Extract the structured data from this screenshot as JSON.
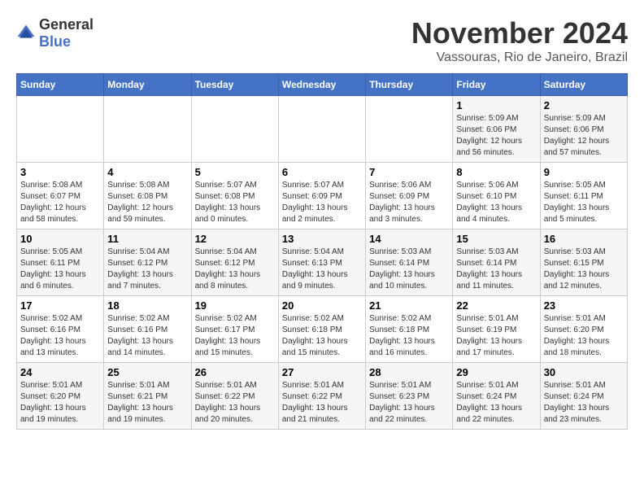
{
  "logo": {
    "general": "General",
    "blue": "Blue"
  },
  "header": {
    "month": "November 2024",
    "location": "Vassouras, Rio de Janeiro, Brazil"
  },
  "weekdays": [
    "Sunday",
    "Monday",
    "Tuesday",
    "Wednesday",
    "Thursday",
    "Friday",
    "Saturday"
  ],
  "weeks": [
    [
      {
        "day": "",
        "info": ""
      },
      {
        "day": "",
        "info": ""
      },
      {
        "day": "",
        "info": ""
      },
      {
        "day": "",
        "info": ""
      },
      {
        "day": "",
        "info": ""
      },
      {
        "day": "1",
        "info": "Sunrise: 5:09 AM\nSunset: 6:06 PM\nDaylight: 12 hours\nand 56 minutes."
      },
      {
        "day": "2",
        "info": "Sunrise: 5:09 AM\nSunset: 6:06 PM\nDaylight: 12 hours\nand 57 minutes."
      }
    ],
    [
      {
        "day": "3",
        "info": "Sunrise: 5:08 AM\nSunset: 6:07 PM\nDaylight: 12 hours\nand 58 minutes."
      },
      {
        "day": "4",
        "info": "Sunrise: 5:08 AM\nSunset: 6:08 PM\nDaylight: 12 hours\nand 59 minutes."
      },
      {
        "day": "5",
        "info": "Sunrise: 5:07 AM\nSunset: 6:08 PM\nDaylight: 13 hours\nand 0 minutes."
      },
      {
        "day": "6",
        "info": "Sunrise: 5:07 AM\nSunset: 6:09 PM\nDaylight: 13 hours\nand 2 minutes."
      },
      {
        "day": "7",
        "info": "Sunrise: 5:06 AM\nSunset: 6:09 PM\nDaylight: 13 hours\nand 3 minutes."
      },
      {
        "day": "8",
        "info": "Sunrise: 5:06 AM\nSunset: 6:10 PM\nDaylight: 13 hours\nand 4 minutes."
      },
      {
        "day": "9",
        "info": "Sunrise: 5:05 AM\nSunset: 6:11 PM\nDaylight: 13 hours\nand 5 minutes."
      }
    ],
    [
      {
        "day": "10",
        "info": "Sunrise: 5:05 AM\nSunset: 6:11 PM\nDaylight: 13 hours\nand 6 minutes."
      },
      {
        "day": "11",
        "info": "Sunrise: 5:04 AM\nSunset: 6:12 PM\nDaylight: 13 hours\nand 7 minutes."
      },
      {
        "day": "12",
        "info": "Sunrise: 5:04 AM\nSunset: 6:12 PM\nDaylight: 13 hours\nand 8 minutes."
      },
      {
        "day": "13",
        "info": "Sunrise: 5:04 AM\nSunset: 6:13 PM\nDaylight: 13 hours\nand 9 minutes."
      },
      {
        "day": "14",
        "info": "Sunrise: 5:03 AM\nSunset: 6:14 PM\nDaylight: 13 hours\nand 10 minutes."
      },
      {
        "day": "15",
        "info": "Sunrise: 5:03 AM\nSunset: 6:14 PM\nDaylight: 13 hours\nand 11 minutes."
      },
      {
        "day": "16",
        "info": "Sunrise: 5:03 AM\nSunset: 6:15 PM\nDaylight: 13 hours\nand 12 minutes."
      }
    ],
    [
      {
        "day": "17",
        "info": "Sunrise: 5:02 AM\nSunset: 6:16 PM\nDaylight: 13 hours\nand 13 minutes."
      },
      {
        "day": "18",
        "info": "Sunrise: 5:02 AM\nSunset: 6:16 PM\nDaylight: 13 hours\nand 14 minutes."
      },
      {
        "day": "19",
        "info": "Sunrise: 5:02 AM\nSunset: 6:17 PM\nDaylight: 13 hours\nand 15 minutes."
      },
      {
        "day": "20",
        "info": "Sunrise: 5:02 AM\nSunset: 6:18 PM\nDaylight: 13 hours\nand 15 minutes."
      },
      {
        "day": "21",
        "info": "Sunrise: 5:02 AM\nSunset: 6:18 PM\nDaylight: 13 hours\nand 16 minutes."
      },
      {
        "day": "22",
        "info": "Sunrise: 5:01 AM\nSunset: 6:19 PM\nDaylight: 13 hours\nand 17 minutes."
      },
      {
        "day": "23",
        "info": "Sunrise: 5:01 AM\nSunset: 6:20 PM\nDaylight: 13 hours\nand 18 minutes."
      }
    ],
    [
      {
        "day": "24",
        "info": "Sunrise: 5:01 AM\nSunset: 6:20 PM\nDaylight: 13 hours\nand 19 minutes."
      },
      {
        "day": "25",
        "info": "Sunrise: 5:01 AM\nSunset: 6:21 PM\nDaylight: 13 hours\nand 19 minutes."
      },
      {
        "day": "26",
        "info": "Sunrise: 5:01 AM\nSunset: 6:22 PM\nDaylight: 13 hours\nand 20 minutes."
      },
      {
        "day": "27",
        "info": "Sunrise: 5:01 AM\nSunset: 6:22 PM\nDaylight: 13 hours\nand 21 minutes."
      },
      {
        "day": "28",
        "info": "Sunrise: 5:01 AM\nSunset: 6:23 PM\nDaylight: 13 hours\nand 22 minutes."
      },
      {
        "day": "29",
        "info": "Sunrise: 5:01 AM\nSunset: 6:24 PM\nDaylight: 13 hours\nand 22 minutes."
      },
      {
        "day": "30",
        "info": "Sunrise: 5:01 AM\nSunset: 6:24 PM\nDaylight: 13 hours\nand 23 minutes."
      }
    ]
  ]
}
